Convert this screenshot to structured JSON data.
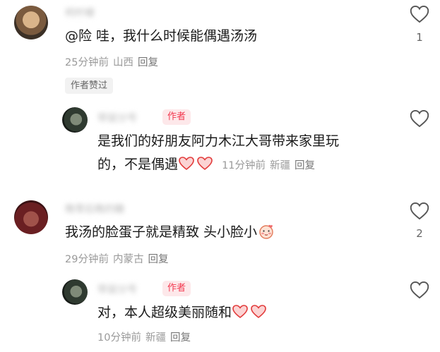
{
  "comments": [
    {
      "name": "柯柠檬",
      "text": "@险 哇，我什么时候能偶遇汤汤",
      "meta": {
        "time": "25分钟前",
        "location": "山西",
        "reply": "回复"
      },
      "badge": "作者赞过",
      "likes": "1",
      "icon": "heart-outline-icon"
    },
    {
      "name": "带鼠分号",
      "author_tag": "作者",
      "text_line1": "是我们的好朋友阿力木江大哥带来家里玩",
      "text_line2": "的，不是偶遇",
      "meta": {
        "time": "11分钟前",
        "location": "新疆",
        "reply": "回复"
      },
      "icon": "heart-outline-icon"
    },
    {
      "name": "晚零后晚的糖",
      "text": "我汤的脸蛋子就是精致 头小脸小",
      "meta": {
        "time": "29分钟前",
        "location": "内蒙古",
        "reply": "回复"
      },
      "likes": "2",
      "icon": "heart-outline-icon"
    },
    {
      "name": "带鼠分号",
      "author_tag": "作者",
      "text": "对，本人超级美丽随和",
      "meta": {
        "time": "10分钟前",
        "location": "新疆",
        "reply": "回复"
      },
      "icon": "heart-outline-icon"
    }
  ],
  "colors": {
    "author_tag_bg": "#fde8ea",
    "author_tag_text": "#f2384f",
    "meta_text": "#9a9a9a"
  }
}
